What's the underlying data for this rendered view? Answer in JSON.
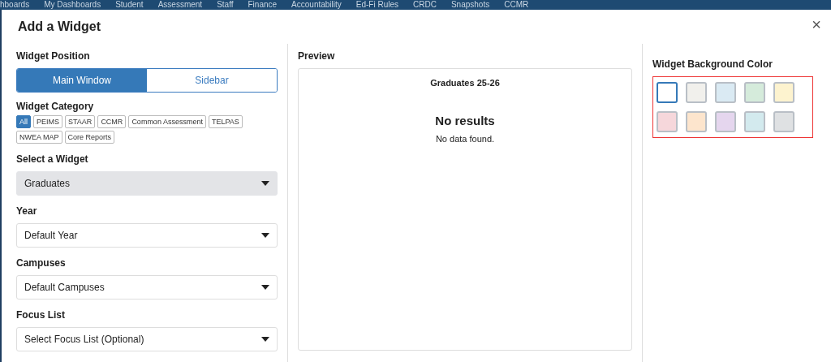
{
  "nav": [
    "hboards",
    "My Dashboards",
    "Student",
    "Assessment",
    "Staff",
    "Finance",
    "Accountability",
    "Ed-Fi Rules",
    "CRDC",
    "Snapshots",
    "CCMR"
  ],
  "dialog": {
    "title": "Add a Widget",
    "close": "×"
  },
  "position": {
    "label": "Widget Position",
    "options": [
      {
        "label": "Main Window",
        "selected": true
      },
      {
        "label": "Sidebar",
        "selected": false
      }
    ]
  },
  "category": {
    "label": "Widget Category",
    "tags": [
      {
        "label": "All",
        "selected": true
      },
      {
        "label": "PEIMS",
        "selected": false
      },
      {
        "label": "STAAR",
        "selected": false
      },
      {
        "label": "CCMR",
        "selected": false
      },
      {
        "label": "Common Assessment",
        "selected": false
      },
      {
        "label": "TELPAS",
        "selected": false
      },
      {
        "label": "NWEA MAP",
        "selected": false
      },
      {
        "label": "Core Reports",
        "selected": false
      }
    ]
  },
  "selects": [
    {
      "label": "Select a Widget",
      "value": "Graduates",
      "disabled": true
    },
    {
      "label": "Year",
      "value": "Default Year",
      "disabled": false
    },
    {
      "label": "Campuses",
      "value": "Default Campuses",
      "disabled": false
    },
    {
      "label": "Focus List",
      "value": "Select Focus List (Optional)",
      "disabled": false
    }
  ],
  "preview": {
    "label": "Preview",
    "widget_title": "Graduates 25-26",
    "heading": "No results",
    "message": "No data found."
  },
  "background": {
    "label": "Widget Background Color",
    "swatches": [
      {
        "color": "#ffffff",
        "selected": true
      },
      {
        "color": "#f1f0ec",
        "selected": false
      },
      {
        "color": "#daeaf3",
        "selected": false
      },
      {
        "color": "#d5ebdb",
        "selected": false
      },
      {
        "color": "#fdf3cf",
        "selected": false
      },
      {
        "color": "#f6d7db",
        "selected": false
      },
      {
        "color": "#fde5cd",
        "selected": false
      },
      {
        "color": "#e5d6ee",
        "selected": false
      },
      {
        "color": "#d3eaee",
        "selected": false
      },
      {
        "color": "#dfe1e3",
        "selected": false
      }
    ]
  }
}
